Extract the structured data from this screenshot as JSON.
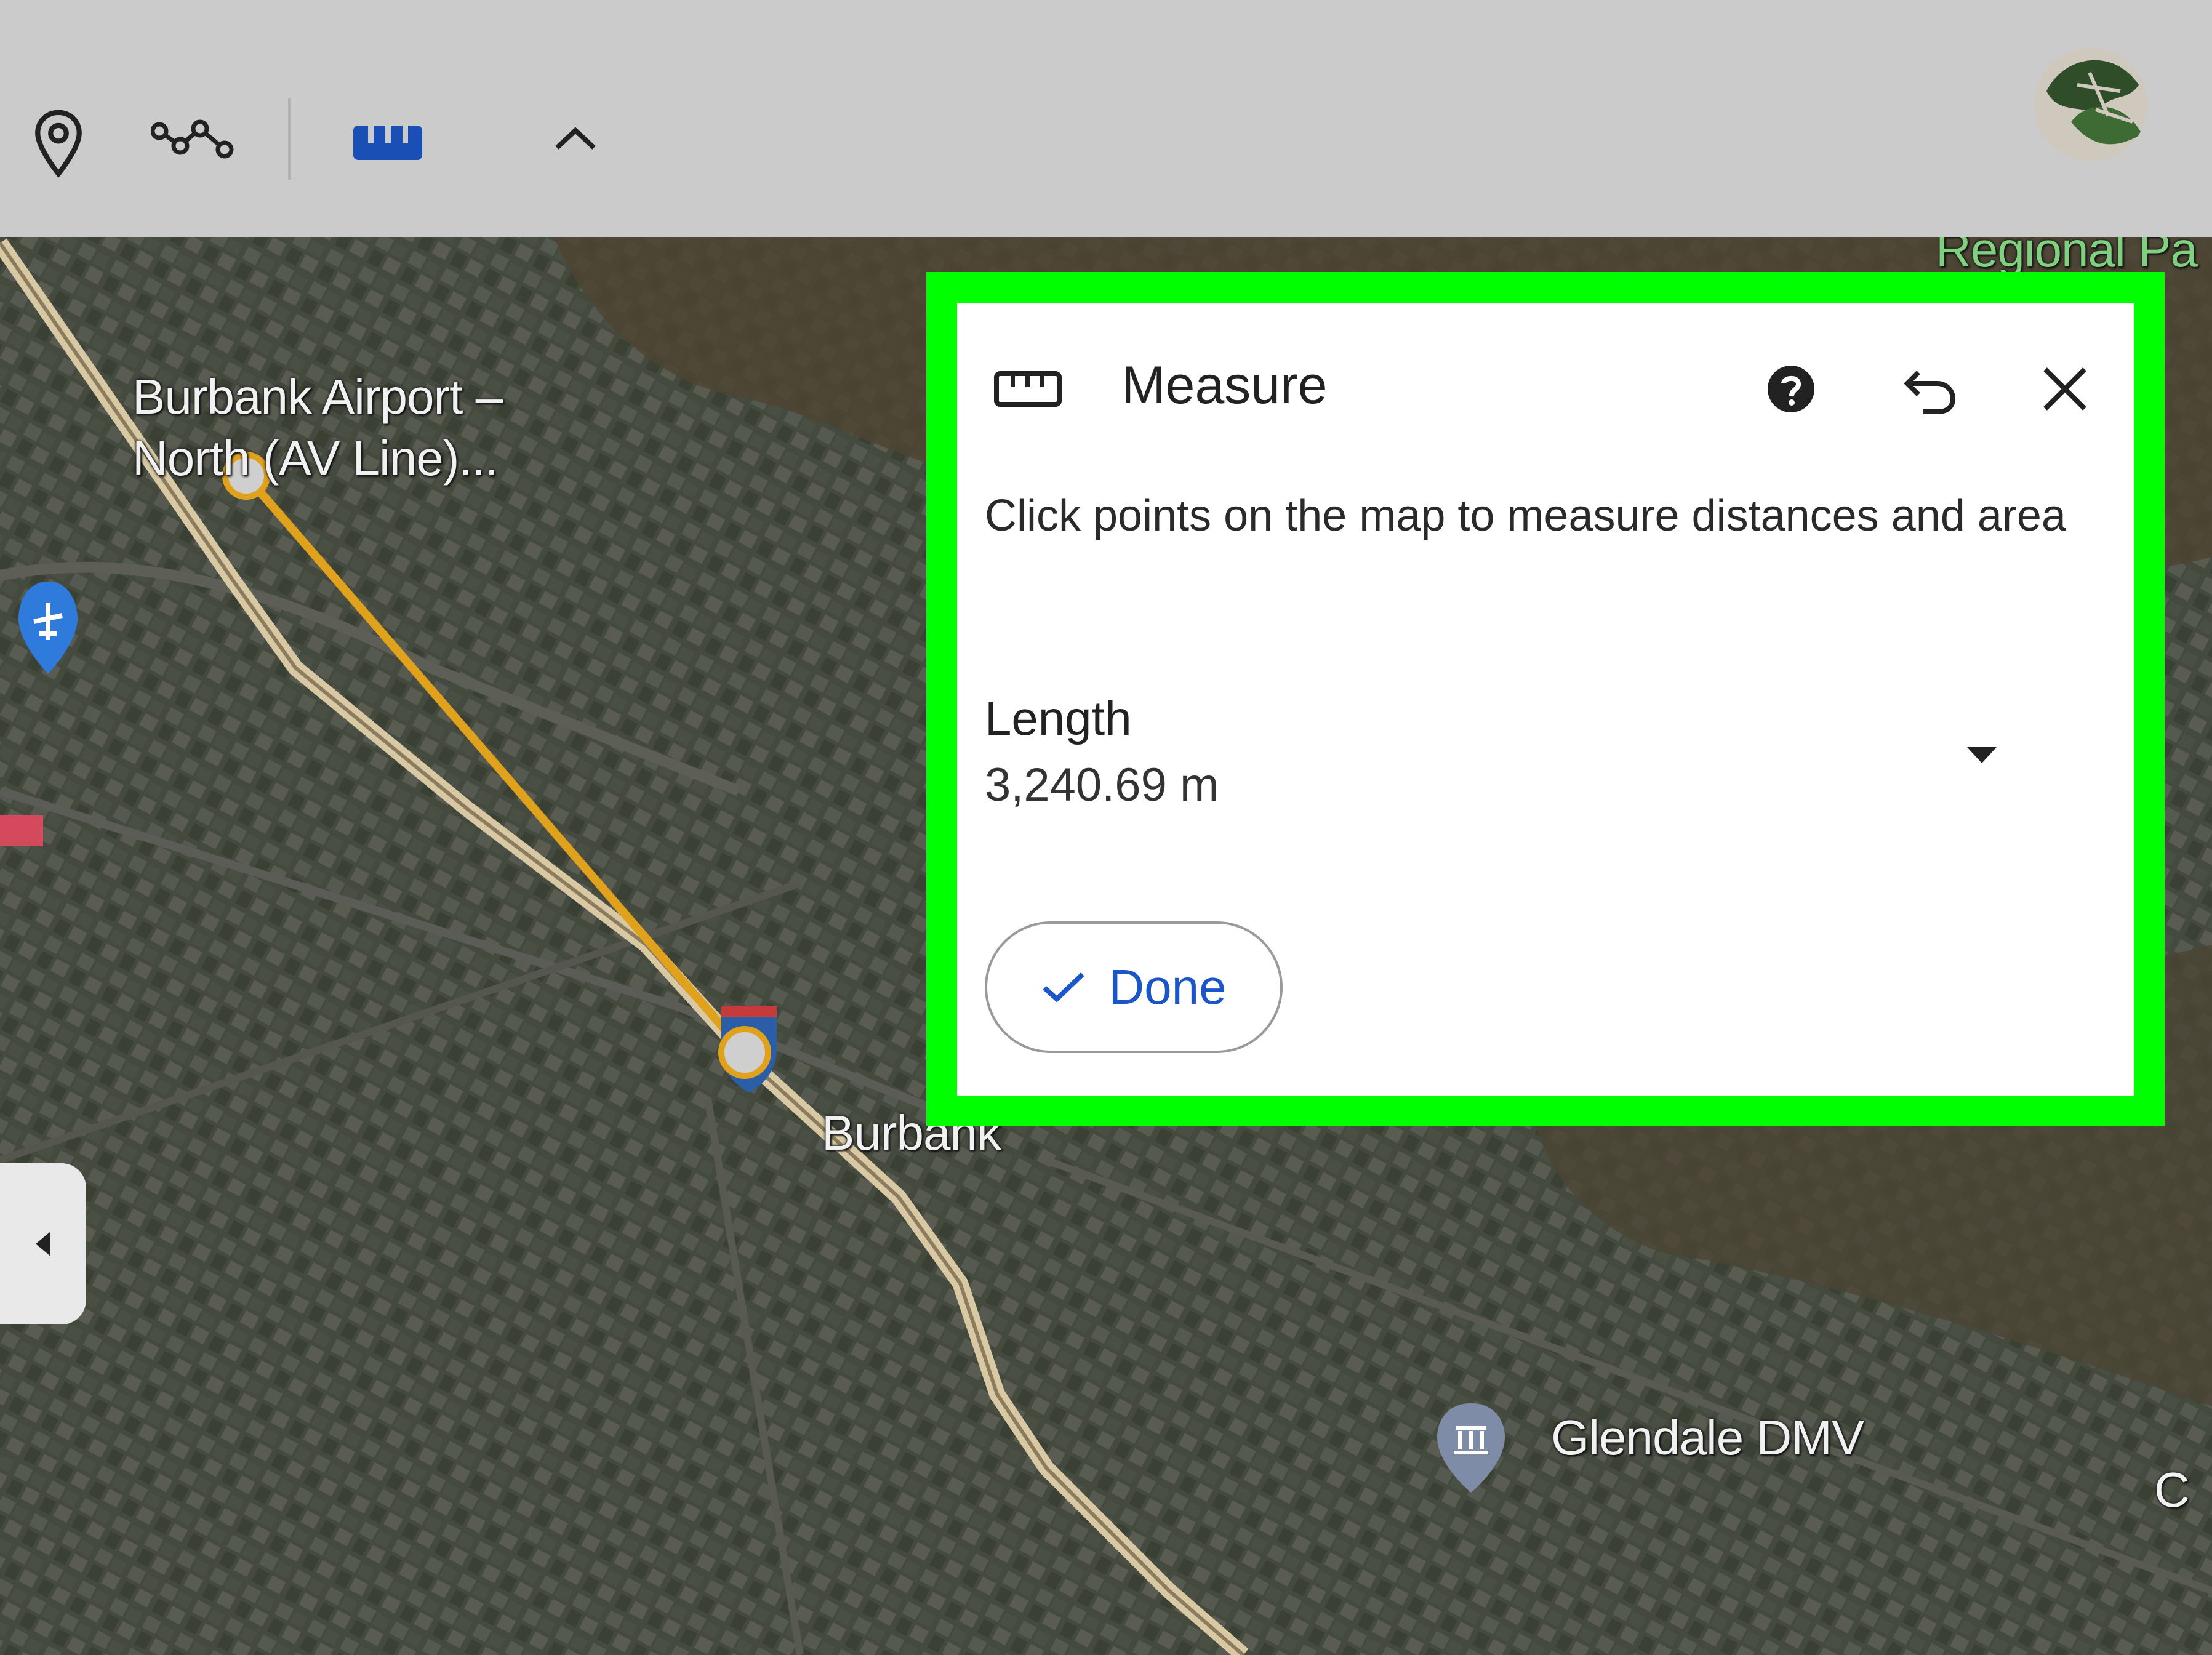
{
  "toolbar": {
    "icons": [
      "map-pin-icon",
      "path-icon",
      "ruler-icon",
      "chevron-up-icon"
    ],
    "active_icon_color": "#1a4fb5"
  },
  "map": {
    "labels": {
      "airport_line1": "Burbank Airport –",
      "airport_line2": "North (AV Line)...",
      "burbank": "Burbank",
      "glendale": "Glendale DMV",
      "regional": "Regional Pa",
      "edge_c": "C"
    },
    "route_color": "#e0a21c"
  },
  "measure": {
    "title": "Measure",
    "description": "Click points on the map to measure distances and area",
    "length_label": "Length",
    "length_value": "3,240.69 m",
    "done_label": "Done",
    "highlight_color": "#00ff00"
  }
}
